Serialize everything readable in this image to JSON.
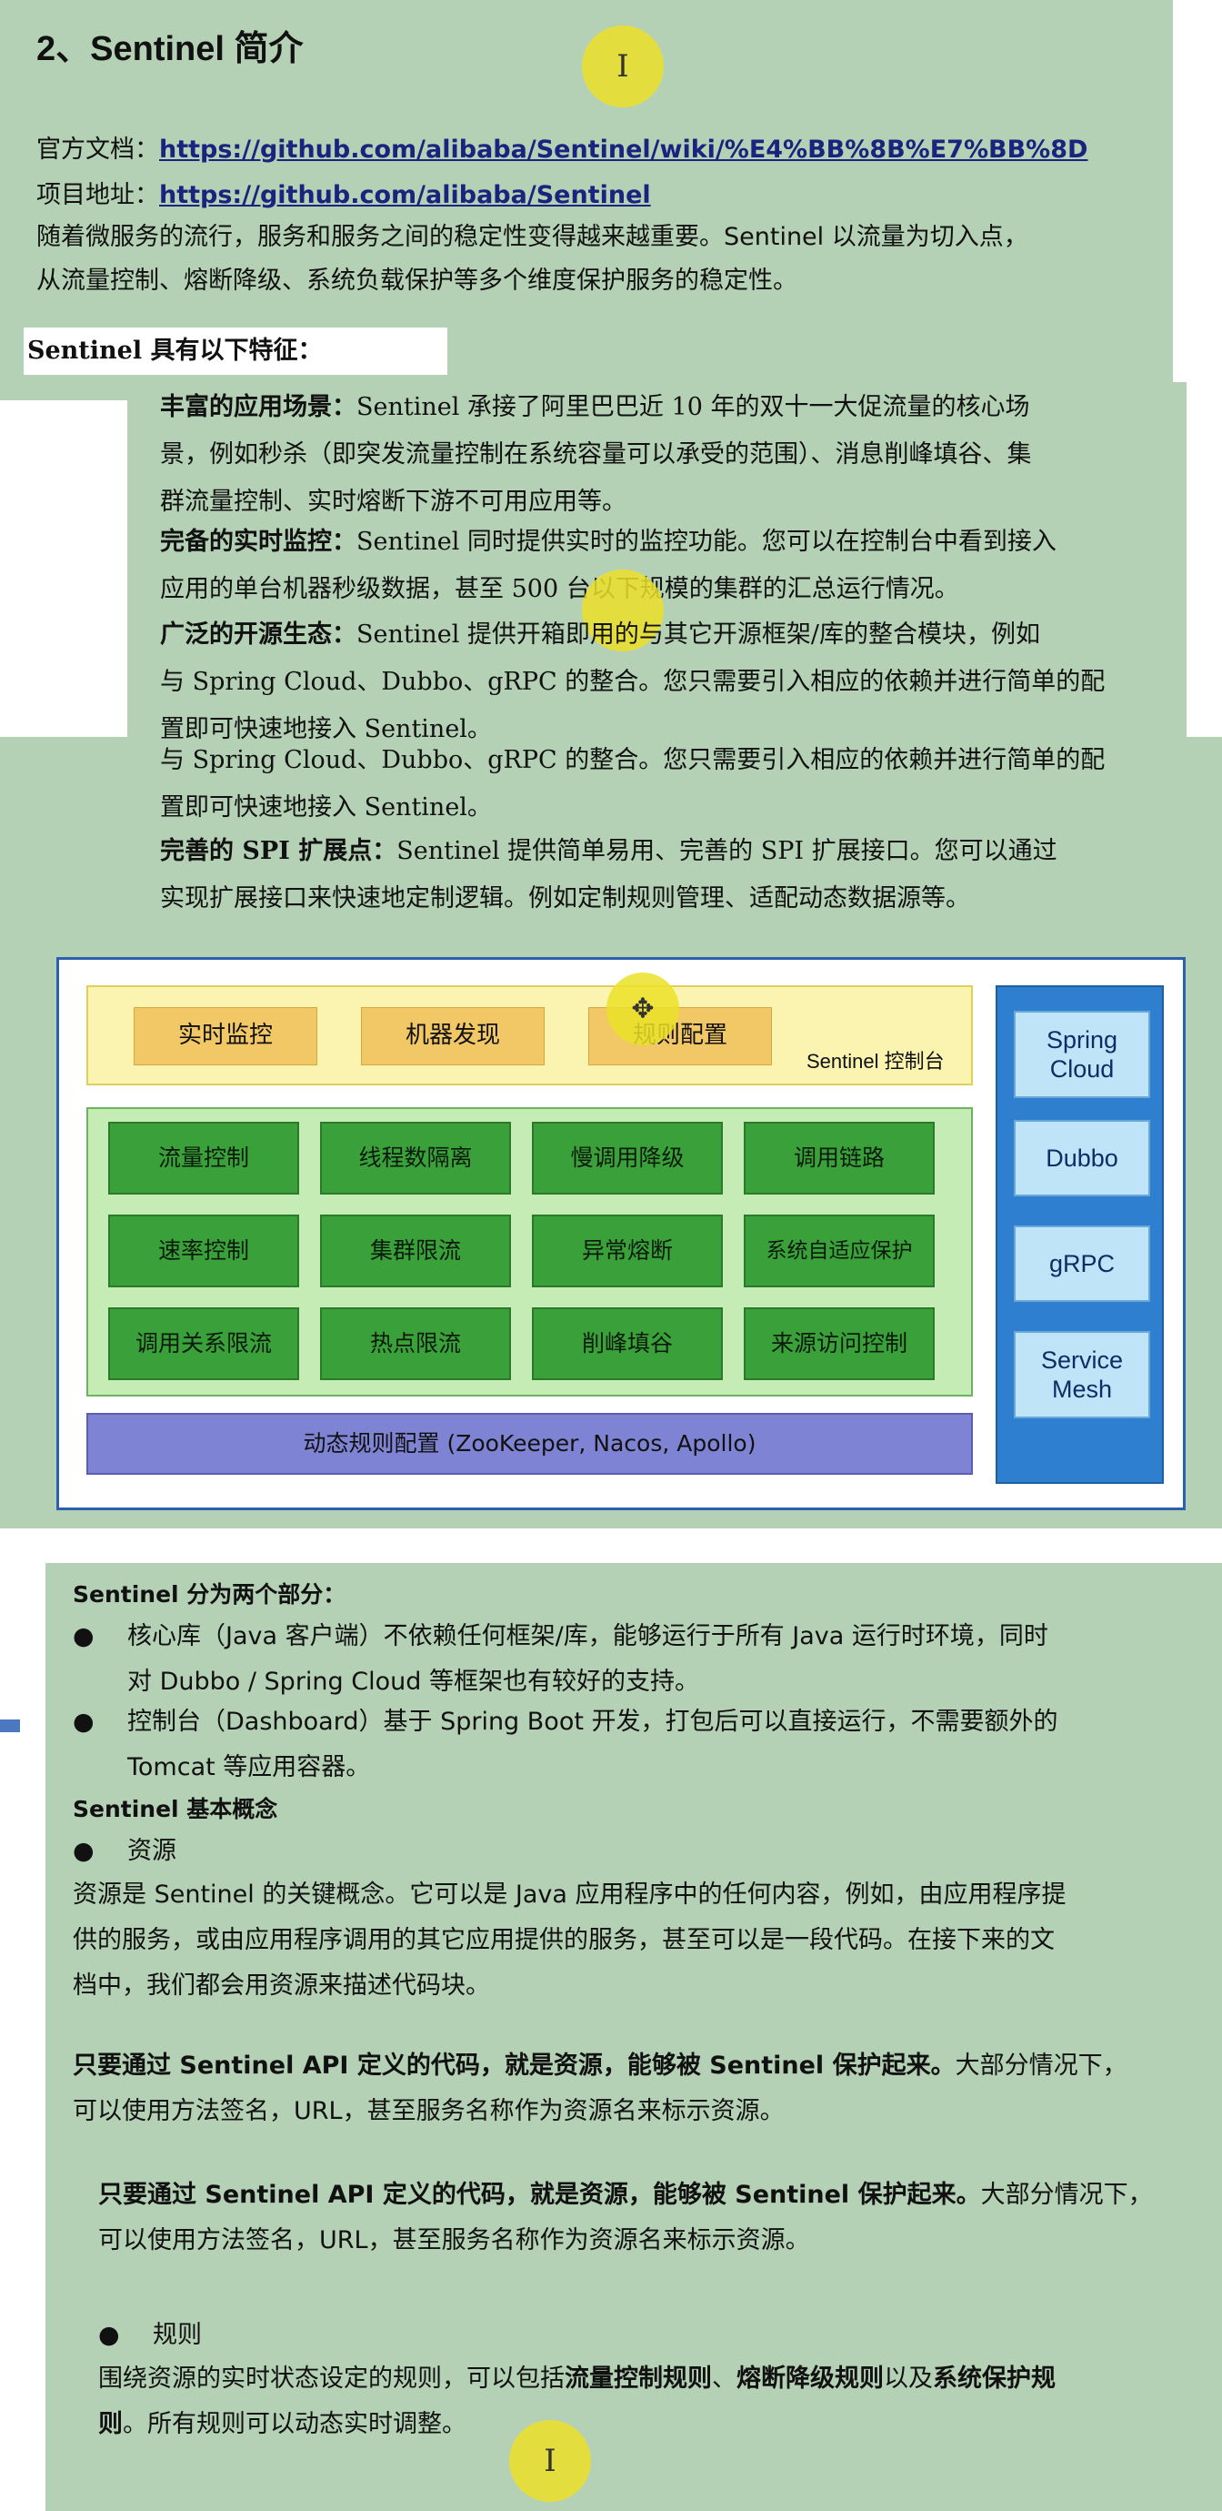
{
  "section1": {
    "title": "2、Sentinel 简介",
    "doc_label": "官方文档：",
    "doc_url": "https://github.com/alibaba/Sentinel/wiki/%E4%BB%8B%E7%BB%8D",
    "repo_label": "项目地址：",
    "repo_url": "https://github.com/alibaba/Sentinel",
    "intro_line1": "随着微服务的流行，服务和服务之间的稳定性变得越来越重要。Sentinel 以流量为切入点，",
    "intro_line2": "从流量控制、熔断降级、系统负载保护等多个维度保护服务的稳定性。",
    "features_heading": "Sentinel 具有以下特征：",
    "cursor_char": "I"
  },
  "features": {
    "f1_label": "丰富的应用场景：",
    "f1_line1": "Sentinel 承接了阿里巴巴近 10 年的双十一大促流量的核心场",
    "f1_line2": "景，例如秒杀（即突发流量控制在系统容量可以承受的范围）、消息削峰填谷、集",
    "f1_line3": "群流量控制、实时熔断下游不可用应用等。",
    "f2_label": "完备的实时监控：",
    "f2_line1": "Sentinel 同时提供实时的监控功能。您可以在控制台中看到接入",
    "f2_line2": "应用的单台机器秒级数据，甚至 500 台以下规模的集群的汇总运行情况。",
    "f3_label": "广泛的开源生态：",
    "f3_line1": "Sentinel 提供开箱即用的与其它开源框架/库的整合模块，例如",
    "f3_line2": "与 Spring Cloud、Dubbo、gRPC 的整合。您只需要引入相应的依赖并进行简单的配",
    "f3_line3": "置即可快速地接入 Sentinel。",
    "f3_dup_line1": "与 Spring Cloud、Dubbo、gRPC 的整合。您只需要引入相应的依赖并进行简单的配",
    "f3_dup_line2": "置即可快速地接入 Sentinel。",
    "f4_label": "完善的 SPI 扩展点：",
    "f4_line1": "Sentinel 提供简单易用、完善的 SPI 扩展接口。您可以通过",
    "f4_line2": "实现扩展接口来快速地定制逻辑。例如定制规则管理、适配动态数据源等。"
  },
  "diagram": {
    "console_items": [
      "实时监控",
      "机器发现",
      "规则配置"
    ],
    "console_label": "Sentinel 控制台",
    "features": [
      [
        "流量控制",
        "线程数隔离",
        "慢调用降级",
        "调用链路"
      ],
      [
        "速率控制",
        "集群限流",
        "异常熔断",
        "系统自适应保护"
      ],
      [
        "调用关系限流",
        "热点限流",
        "削峰填谷",
        "来源访问控制"
      ]
    ],
    "dynamic_rules": "动态规则配置 (ZooKeeper, Nacos, Apollo)",
    "integrations": [
      "Spring Cloud",
      "Dubbo",
      "gRPC",
      "Service Mesh"
    ],
    "colors": {
      "console": "#faf4b0",
      "console_button": "#f2c766",
      "feature_area": "#c4ecb4",
      "feature_button": "#3aa13a",
      "dynamic_rules": "#7f83d3",
      "integration_panel": "#2f7fd0",
      "integration_button": "#bfe4f7"
    }
  },
  "section2": {
    "parts_heading": "Sentinel 分为两个部分：",
    "part1_line1": "核心库（Java 客户端）不依赖任何框架/库，能够运行于所有 Java 运行时环境，同时",
    "part1_line2": "对 Dubbo / Spring Cloud 等框架也有较好的支持。",
    "part2_line1": "控制台（Dashboard）基于 Spring Boot 开发，打包后可以直接运行，不需要额外的",
    "part2_line2": "Tomcat 等应用容器。",
    "concepts_heading": "Sentinel 基本概念",
    "resource_bullet": "资源",
    "resource_line1": "资源是 Sentinel 的关键概念。它可以是 Java 应用程序中的任何内容，例如，由应用程序提",
    "resource_line2": "供的服务，或由应用程序调用的其它应用提供的服务，甚至可以是一段代码。在接下来的文",
    "resource_line3": "档中，我们都会用资源来描述代码块。",
    "api_bold": "只要通过 Sentinel API 定义的代码，就是资源，能够被 Sentinel 保护起来。",
    "api_rest": "大部分情况下，",
    "api_line2": "可以使用方法签名，URL，甚至服务名称作为资源名来标示资源。",
    "api2_bold": "只要通过 Sentinel API 定义的代码，就是资源，能够被 Sentinel 保护起来。",
    "api2_rest": "大部分情况下，",
    "api2_line2": "可以使用方法签名，URL，甚至服务名称作为资源名来标示资源。",
    "rules_bullet": "规则",
    "rules_line1_a": "围绕资源的实时状态设定的规则，可以包括",
    "rules_line1_b": "流量控制规则",
    "rules_line1_c": "、",
    "rules_line1_d": "熔断降级规则",
    "rules_line1_e": "以及",
    "rules_line1_f": "系统保护规",
    "rules_line2_a": "则",
    "rules_line2_b": "。所有规则可以动态实时调整。",
    "bullet_char": "●",
    "cursor_char": "I"
  }
}
